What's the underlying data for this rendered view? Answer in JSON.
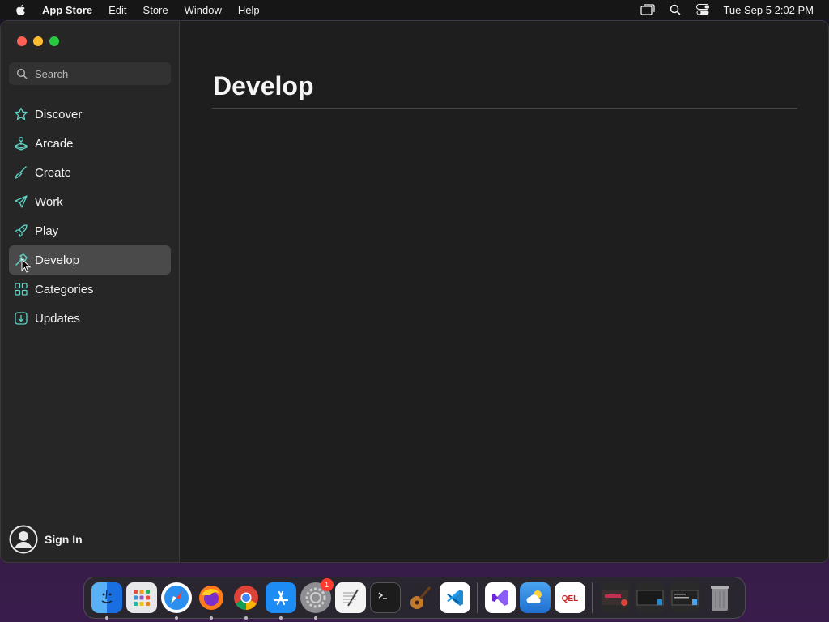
{
  "menubar": {
    "app_name": "App Store",
    "items": [
      "Edit",
      "Store",
      "Window",
      "Help"
    ],
    "clock": "Tue Sep 5  2:02 PM"
  },
  "sidebar": {
    "search_placeholder": "Search",
    "items": [
      {
        "label": "Discover",
        "icon": "star-icon"
      },
      {
        "label": "Arcade",
        "icon": "joystick-icon"
      },
      {
        "label": "Create",
        "icon": "brush-icon"
      },
      {
        "label": "Work",
        "icon": "paperplane-icon"
      },
      {
        "label": "Play",
        "icon": "rocket-icon"
      },
      {
        "label": "Develop",
        "icon": "hammer-icon",
        "selected": true
      },
      {
        "label": "Categories",
        "icon": "grid-icon"
      },
      {
        "label": "Updates",
        "icon": "download-icon"
      }
    ],
    "sign_in": "Sign In"
  },
  "main": {
    "title": "Develop"
  },
  "dock": {
    "settings_badge": "1",
    "apps": [
      "Finder",
      "Launchpad",
      "Safari",
      "Firefox",
      "Chrome",
      "App Store",
      "System Settings",
      "TextEdit",
      "Terminal",
      "GarageBand",
      "VS Code",
      "Visual Studio",
      "Weather",
      "QEL"
    ]
  },
  "colors": {
    "accent": "#5fd4c4",
    "sidebar_bg": "#262626",
    "content_bg": "#1e1e1e",
    "selected_bg": "#4a4a4a"
  }
}
